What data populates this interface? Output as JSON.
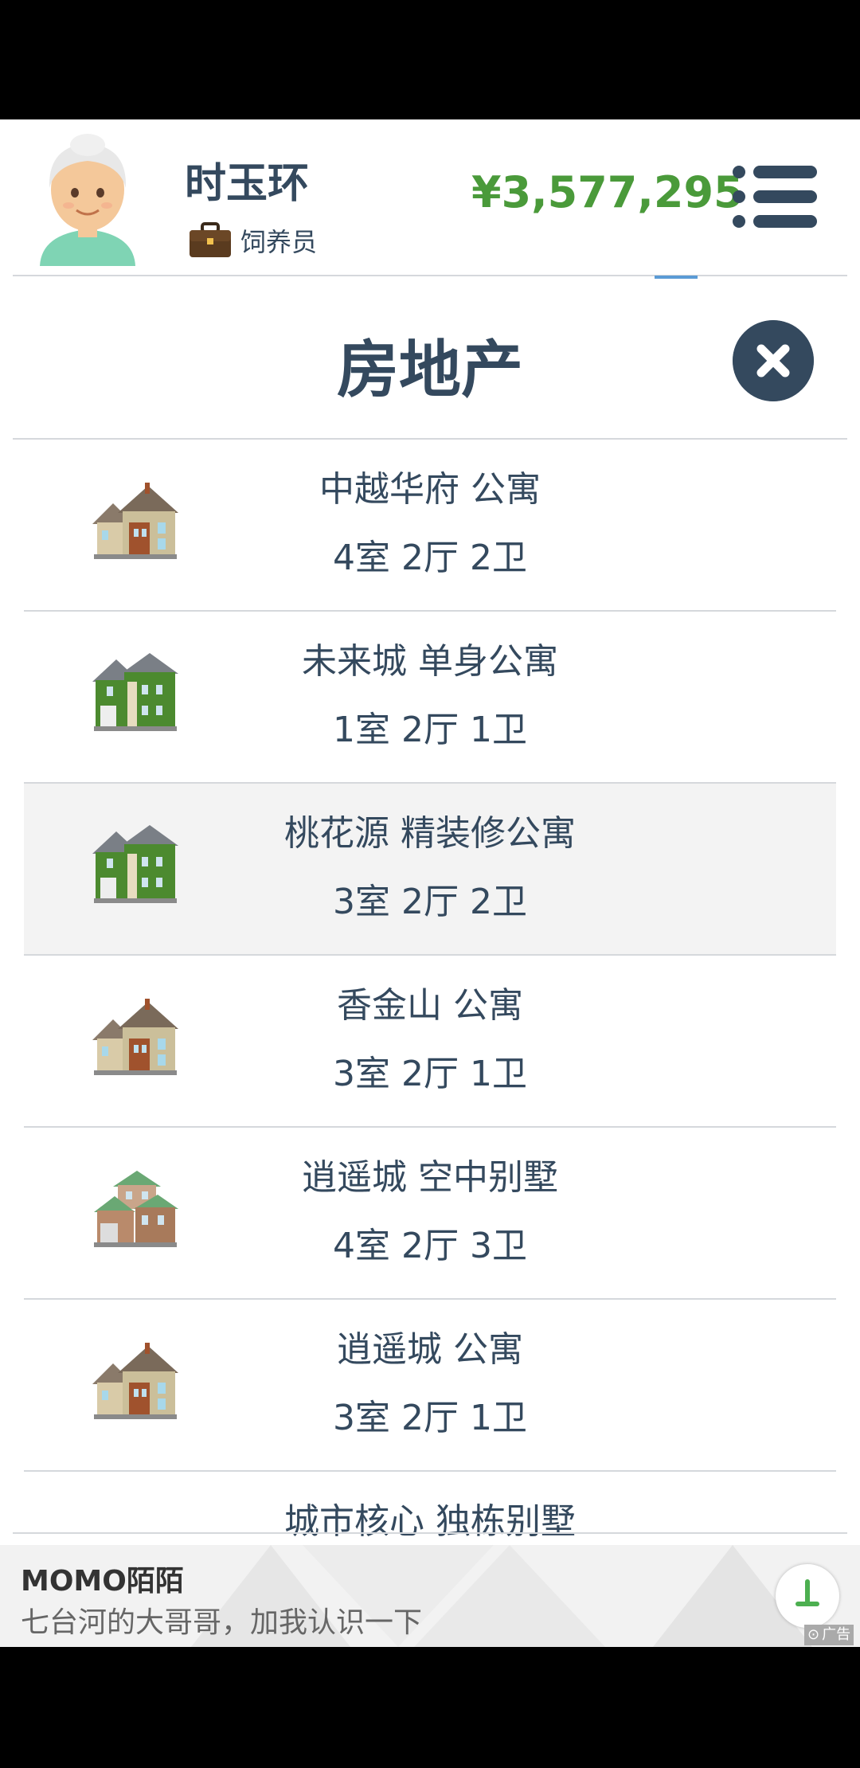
{
  "header": {
    "name": "时玉环",
    "job": "饲养员",
    "money": "¥3,577,295"
  },
  "modal": {
    "title": "房地产"
  },
  "properties": [
    {
      "name": "中越华府 公寓",
      "rooms": "4室 2厅 2卫",
      "house_style": "brown"
    },
    {
      "name": "未来城 单身公寓",
      "rooms": "1室 2厅 1卫",
      "house_style": "green"
    },
    {
      "name": "桃花源 精装修公寓",
      "rooms": "3室 2厅 2卫",
      "house_style": "green",
      "selected": true
    },
    {
      "name": "香金山 公寓",
      "rooms": "3室 2厅 1卫",
      "house_style": "brown"
    },
    {
      "name": "逍遥城 空中别墅",
      "rooms": "4室 2厅 3卫",
      "house_style": "villa"
    },
    {
      "name": "逍遥城 公寓",
      "rooms": "3室 2厅 1卫",
      "house_style": "brown"
    },
    {
      "name": "城市核心 独栋别墅",
      "rooms": "",
      "house_style": "none"
    }
  ],
  "ad": {
    "title": "MOMO陌陌",
    "text": "七台河的大哥哥，加我认识一下",
    "label": "广告"
  }
}
